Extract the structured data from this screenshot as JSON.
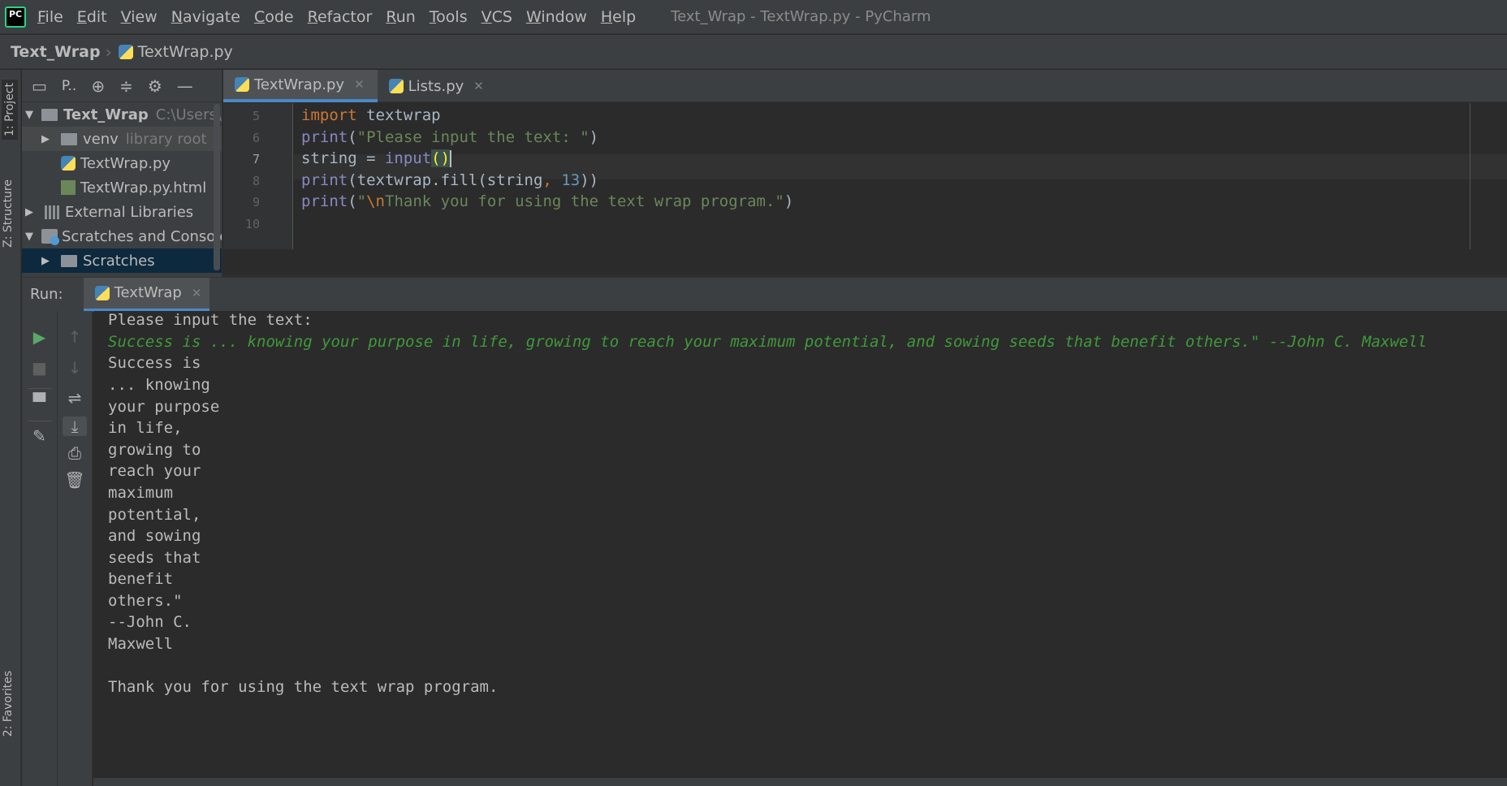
{
  "menubar": {
    "items": [
      "File",
      "Edit",
      "View",
      "Navigate",
      "Code",
      "Refactor",
      "Run",
      "Tools",
      "VCS",
      "Window",
      "Help"
    ],
    "window_title": "Text_Wrap - TextWrap.py - PyCharm",
    "logo_text": "PC"
  },
  "breadcrumb": {
    "project": "Text_Wrap",
    "file": "TextWrap.py"
  },
  "left_strip": {
    "project_tab": "1: Project",
    "structure_tab": "Z: Structure",
    "favorites_tab": "2: Favorites"
  },
  "project_panel": {
    "view_selector": "P..",
    "tree": [
      {
        "label": "Text_Wrap",
        "detail": "C:\\Users\\ro"
      },
      {
        "label": "venv",
        "detail": "library root"
      },
      {
        "label": "TextWrap.py"
      },
      {
        "label": "TextWrap.py.html"
      },
      {
        "label": "External Libraries"
      },
      {
        "label": "Scratches and Consoles"
      },
      {
        "label": "Scratches"
      }
    ]
  },
  "editor": {
    "tabs": [
      {
        "label": "TextWrap.py",
        "active": true
      },
      {
        "label": "Lists.py",
        "active": false
      }
    ],
    "line_numbers": [
      "5",
      "6",
      "7",
      "8",
      "9",
      "10"
    ],
    "code": {
      "l5_kw": "import",
      "l5_rest": " textwrap",
      "l6_fn": "print",
      "l6_open": "(",
      "l6_str": "\"Please input the text: \"",
      "l6_close": ")",
      "l7_a": "string = ",
      "l7_fn": "input",
      "l7_brace": "()",
      "l8_fn": "print",
      "l8_a": "(textwrap.fill(string",
      "l8_comma": ", ",
      "l8_num": "13",
      "l8_close": "))",
      "l9_fn": "print",
      "l9_open": "(",
      "l9_q": "\"",
      "l9_esc": "\\n",
      "l9_str": "Thank you for using the text wrap program.\"",
      "l9_close": ")"
    }
  },
  "run_panel": {
    "label": "Run:",
    "tab": "TextWrap",
    "output": [
      {
        "text": "Please input the text:",
        "type": "stdout"
      },
      {
        "text": "Success is ... knowing your purpose in life, growing to reach your maximum potential, and sowing seeds that benefit others.\" --John C. Maxwell",
        "type": "input"
      },
      {
        "text": "Success is",
        "type": "stdout"
      },
      {
        "text": "... knowing",
        "type": "stdout"
      },
      {
        "text": "your purpose",
        "type": "stdout"
      },
      {
        "text": "in life,",
        "type": "stdout"
      },
      {
        "text": "growing to",
        "type": "stdout"
      },
      {
        "text": "reach your",
        "type": "stdout"
      },
      {
        "text": "maximum",
        "type": "stdout"
      },
      {
        "text": "potential,",
        "type": "stdout"
      },
      {
        "text": "and sowing",
        "type": "stdout"
      },
      {
        "text": "seeds that",
        "type": "stdout"
      },
      {
        "text": "benefit",
        "type": "stdout"
      },
      {
        "text": "others.\"",
        "type": "stdout"
      },
      {
        "text": "--John C.",
        "type": "stdout"
      },
      {
        "text": "Maxwell",
        "type": "stdout"
      },
      {
        "text": "",
        "type": "stdout"
      },
      {
        "text": "Thank you for using the text wrap program.",
        "type": "stdout"
      }
    ]
  },
  "colors": {
    "background": "#2b2b2b",
    "panel": "#3c3f41",
    "accent": "#4a88c7",
    "keyword": "#cc7832",
    "string": "#6a8759",
    "input_text": "#3f9a3a"
  }
}
